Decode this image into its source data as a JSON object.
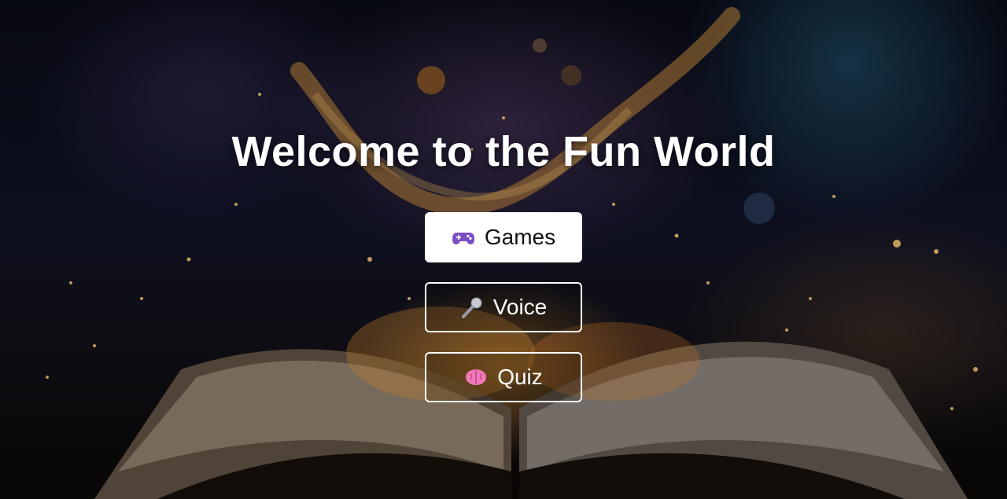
{
  "page": {
    "title": "Welcome to the Fun World"
  },
  "menu": [
    {
      "label": "Games",
      "icon": "game-controller-icon",
      "active": true
    },
    {
      "label": "Voice",
      "icon": "microphone-icon",
      "active": false
    },
    {
      "label": "Quiz",
      "icon": "brain-icon",
      "active": false
    }
  ],
  "colors": {
    "text": "#ffffff",
    "active_bg": "#ffffff",
    "active_text": "#111111",
    "controller": "#7a4fc4",
    "brain": "#f07ab8"
  }
}
